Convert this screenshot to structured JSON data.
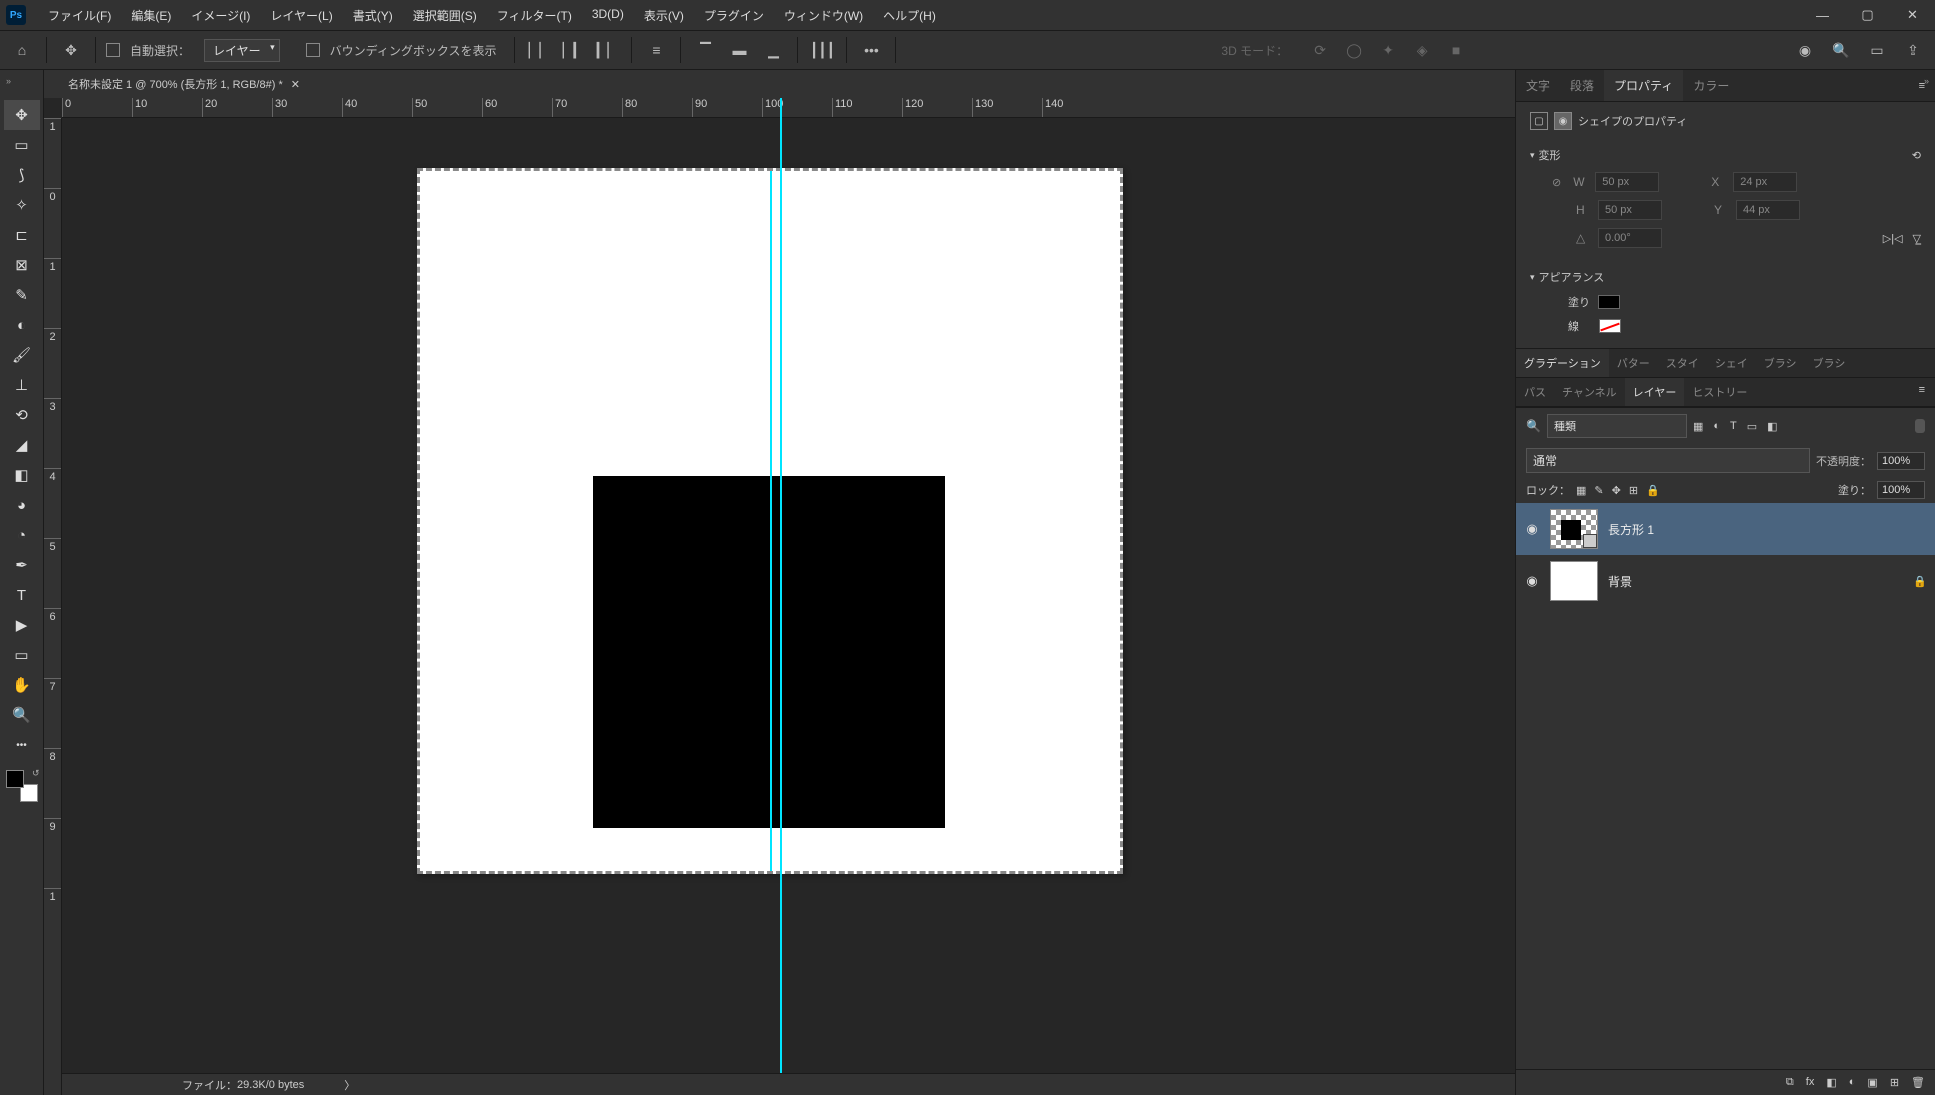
{
  "app": {
    "icon_text": "Ps"
  },
  "menu": {
    "file": "ファイル(F)",
    "edit": "編集(E)",
    "image": "イメージ(I)",
    "layer": "レイヤー(L)",
    "type": "書式(Y)",
    "select": "選択範囲(S)",
    "filter": "フィルター(T)",
    "3d": "3D(D)",
    "view": "表示(V)",
    "plugins": "プラグイン",
    "window": "ウィンドウ(W)",
    "help": "ヘルプ(H)"
  },
  "optbar": {
    "auto_select": "自動選択：",
    "target": "レイヤー",
    "show_bbox": "バウンディングボックスを表示",
    "mode3d": "3D モード："
  },
  "doc": {
    "tab_title": "名称未設定 1 @ 700% (長方形 1, RGB/8#) *",
    "status_file": "ファイル：",
    "status_size": "29.3K/0 bytes"
  },
  "ruler_h": [
    "0",
    "10",
    "20",
    "30",
    "40",
    "50",
    "60",
    "70",
    "80",
    "90",
    "100",
    "110",
    "120",
    "130",
    "140"
  ],
  "ruler_v": [
    "1",
    "0",
    "1",
    "2",
    "3",
    "4",
    "5",
    "6",
    "7",
    "8",
    "9",
    "1"
  ],
  "tabs": {
    "char": "文字",
    "para": "段落",
    "props": "プロパティ",
    "color": "カラー"
  },
  "properties": {
    "header": "シェイプのプロパティ",
    "transform": "変形",
    "w": "W",
    "w_val": "50 px",
    "h": "H",
    "h_val": "50 px",
    "x": "X",
    "x_val": "24 px",
    "y": "Y",
    "y_val": "44 px",
    "angle_val": "0.00°",
    "appearance": "アピアランス",
    "fill": "塗り",
    "stroke": "線"
  },
  "section_tabs": {
    "grad": "グラデーション",
    "patt": "パター",
    "style": "スタイ",
    "shape": "シェイ",
    "brush": "ブラシ",
    "brushset": "ブラシ"
  },
  "section_tabs2": {
    "path": "パス",
    "channel": "チャンネル",
    "layers": "レイヤー",
    "history": "ヒストリー"
  },
  "layers": {
    "filter_type": "種類",
    "blend": "通常",
    "opacity_label": "不透明度：",
    "opacity": "100%",
    "lock": "ロック：",
    "fill_label": "塗り：",
    "fill_opacity": "100%",
    "layer1": "長方形 1",
    "bg": "背景"
  }
}
